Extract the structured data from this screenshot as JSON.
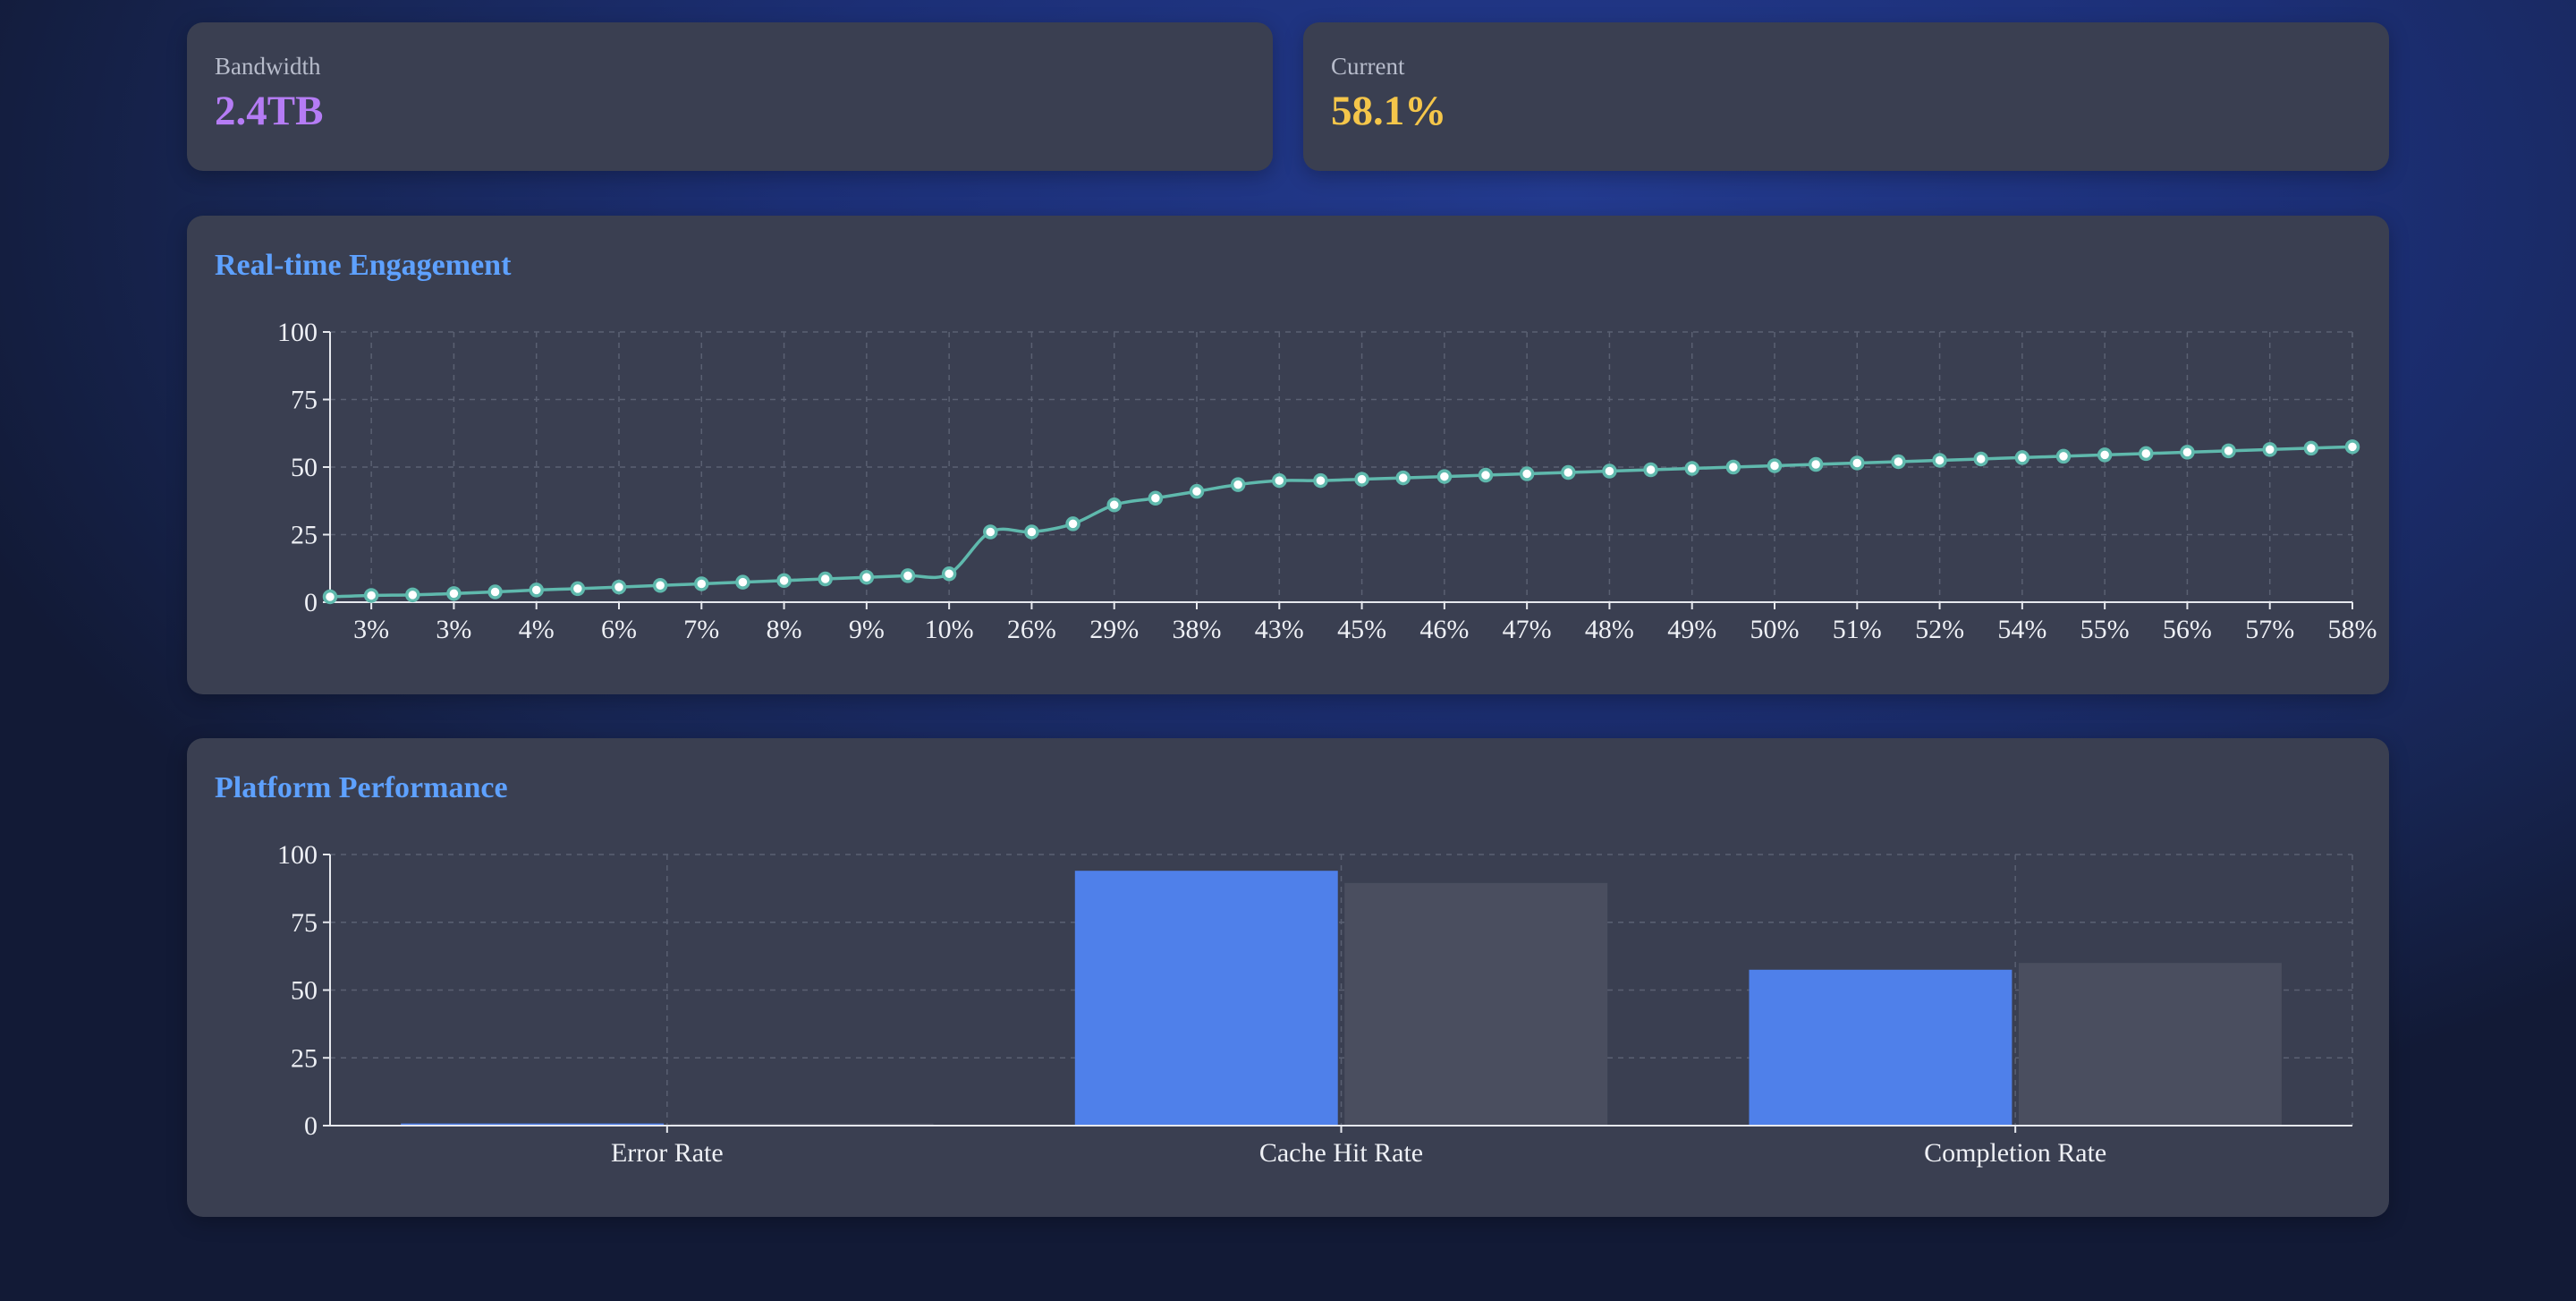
{
  "stats": {
    "bandwidth": {
      "label": "Bandwidth",
      "value": "2.4TB",
      "color": "#b57cf5"
    },
    "current": {
      "label": "Current",
      "value": "58.1%",
      "color": "#f5c64a"
    }
  },
  "colors": {
    "line": "#5fb9ad",
    "bar_primary": "#4f80ea",
    "bar_secondary": "#4a4e5f"
  },
  "chart_data": [
    {
      "type": "line",
      "title": "Real-time Engagement",
      "xlabel": "",
      "ylabel": "",
      "ylim": [
        0,
        100
      ],
      "yticks": [
        0,
        25,
        50,
        75,
        100
      ],
      "grid": true,
      "x_tick_labels": [
        "3%",
        "3%",
        "4%",
        "6%",
        "7%",
        "8%",
        "9%",
        "10%",
        "26%",
        "29%",
        "38%",
        "43%",
        "45%",
        "46%",
        "47%",
        "48%",
        "49%",
        "50%",
        "51%",
        "52%",
        "54%",
        "55%",
        "56%",
        "57%",
        "58%"
      ],
      "values": [
        2,
        2.5,
        2.7,
        3.2,
        3.8,
        4.5,
        5,
        5.6,
        6.2,
        6.8,
        7.4,
        8,
        8.6,
        9.2,
        9.8,
        10.5,
        26,
        26,
        29,
        36,
        38.5,
        41,
        43.5,
        45,
        45,
        45.5,
        46,
        46.5,
        47,
        47.5,
        48,
        48.5,
        49,
        49.5,
        50,
        50.5,
        51,
        51.5,
        52,
        52.5,
        53,
        53.5,
        54,
        54.5,
        55,
        55.5,
        56,
        56.5,
        57,
        57.5
      ]
    },
    {
      "type": "bar",
      "title": "Platform Performance",
      "xlabel": "",
      "ylabel": "",
      "ylim": [
        0,
        100
      ],
      "yticks": [
        0,
        25,
        50,
        75,
        100
      ],
      "grid": true,
      "categories": [
        "Error Rate",
        "Cache Hit Rate",
        "Completion Rate"
      ],
      "series": [
        {
          "values": [
            0.8,
            94,
            57.5
          ]
        },
        {
          "values": [
            0.8,
            89.5,
            60
          ]
        }
      ]
    }
  ]
}
